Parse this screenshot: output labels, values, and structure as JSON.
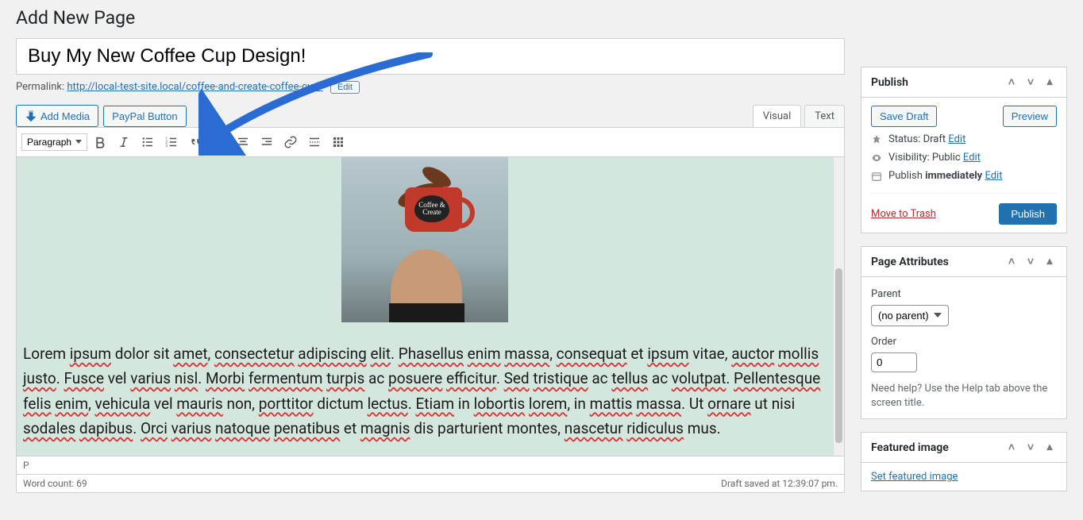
{
  "heading": "Add New Page",
  "title_value": "Buy My New Coffee Cup Design!",
  "permalink": {
    "label": "Permalink:",
    "url_prefix": "http://local-test-site.local/",
    "slug": "coffee-and-create-coffee-cup/",
    "edit": "Edit"
  },
  "buttons": {
    "add_media": "Add Media",
    "paypal": "PayPal Button"
  },
  "editor_tabs": {
    "visual": "Visual",
    "text": "Text",
    "active": "visual"
  },
  "format_select": "Paragraph",
  "image_badge": "Coffee & Create",
  "lorem": "Lorem ipsum dolor sit amet, consectetur adipiscing elit. Phasellus enim massa, consequat et ipsum vitae, auctor mollis justo. Fusce vel varius nisl. Morbi fermentum turpis ac posuere efficitur. Sed tristique ac tellus ac volutpat. Pellentesque felis enim, vehicula vel mauris non, porttitor dictum lectus. Etiam in lobortis lorem, in mattis massa. Ut ornare ut nisi sodales dapibus. Orci varius natoque penatibus et magnis dis parturient montes, nascetur ridiculus mus.",
  "status_path": "P",
  "word_count_label": "Word count: 69",
  "draft_saved": "Draft saved at 12:39:07 pm.",
  "publish_box": {
    "title": "Publish",
    "save_draft": "Save Draft",
    "preview": "Preview",
    "status_label": "Status:",
    "status_value": "Draft",
    "visibility_label": "Visibility:",
    "visibility_value": "Public",
    "schedule_label": "Publish",
    "schedule_value": "immediately",
    "edit": "Edit",
    "trash": "Move to Trash",
    "publish_btn": "Publish"
  },
  "page_attr": {
    "title": "Page Attributes",
    "parent_label": "Parent",
    "parent_value": "(no parent)",
    "order_label": "Order",
    "order_value": "0",
    "help": "Need help? Use the Help tab above the screen title."
  },
  "featured": {
    "title": "Featured image",
    "link": "Set featured image"
  }
}
